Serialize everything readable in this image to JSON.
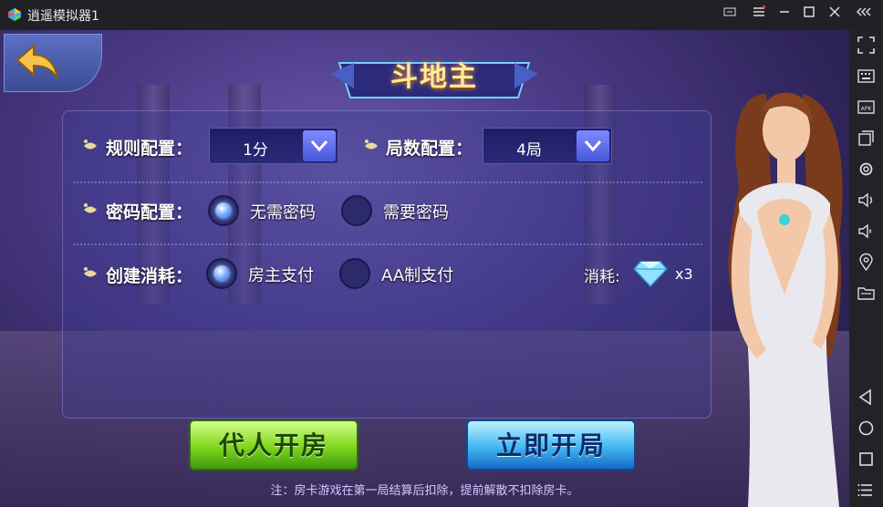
{
  "window": {
    "title": "逍遥模拟器1",
    "controls": [
      "switch-screen-icon",
      "menu-icon",
      "minimize-icon",
      "maximize-icon",
      "close-icon",
      "collapse-icon"
    ]
  },
  "sidebar": {
    "icons": [
      "fullscreen-icon",
      "keyboard-icon",
      "apk-install-icon",
      "multi-window-icon",
      "settings-icon",
      "volume-up-icon",
      "volume-down-icon",
      "location-icon",
      "folder-icon",
      "back-icon",
      "home-icon",
      "recent-apps-icon",
      "more-icon"
    ]
  },
  "game": {
    "title": "斗地主",
    "rules": {
      "label": "规则配置：",
      "value": "1分"
    },
    "rounds": {
      "label": "局数配置：",
      "value": "4局"
    },
    "password": {
      "label": "密码配置：",
      "options": [
        {
          "label": "无需密码",
          "selected": true
        },
        {
          "label": "需要密码",
          "selected": false
        }
      ]
    },
    "cost_config": {
      "label": "创建消耗：",
      "options": [
        {
          "label": "房主支付",
          "selected": true
        },
        {
          "label": "AA制支付",
          "selected": false
        }
      ],
      "consume_label": "消耗:",
      "consume_count": "x3"
    },
    "buttons": {
      "proxy": "代人开房",
      "start": "立即开局"
    },
    "note": "注：房卡游戏在第一局结算后扣除，提前解散不扣除房卡。"
  },
  "colors": {
    "titlebar": "#202124",
    "sidebar": "#222326",
    "accent_blue": "#4657d8",
    "button_green": "#7fd61c",
    "button_blue": "#41b8f2"
  }
}
